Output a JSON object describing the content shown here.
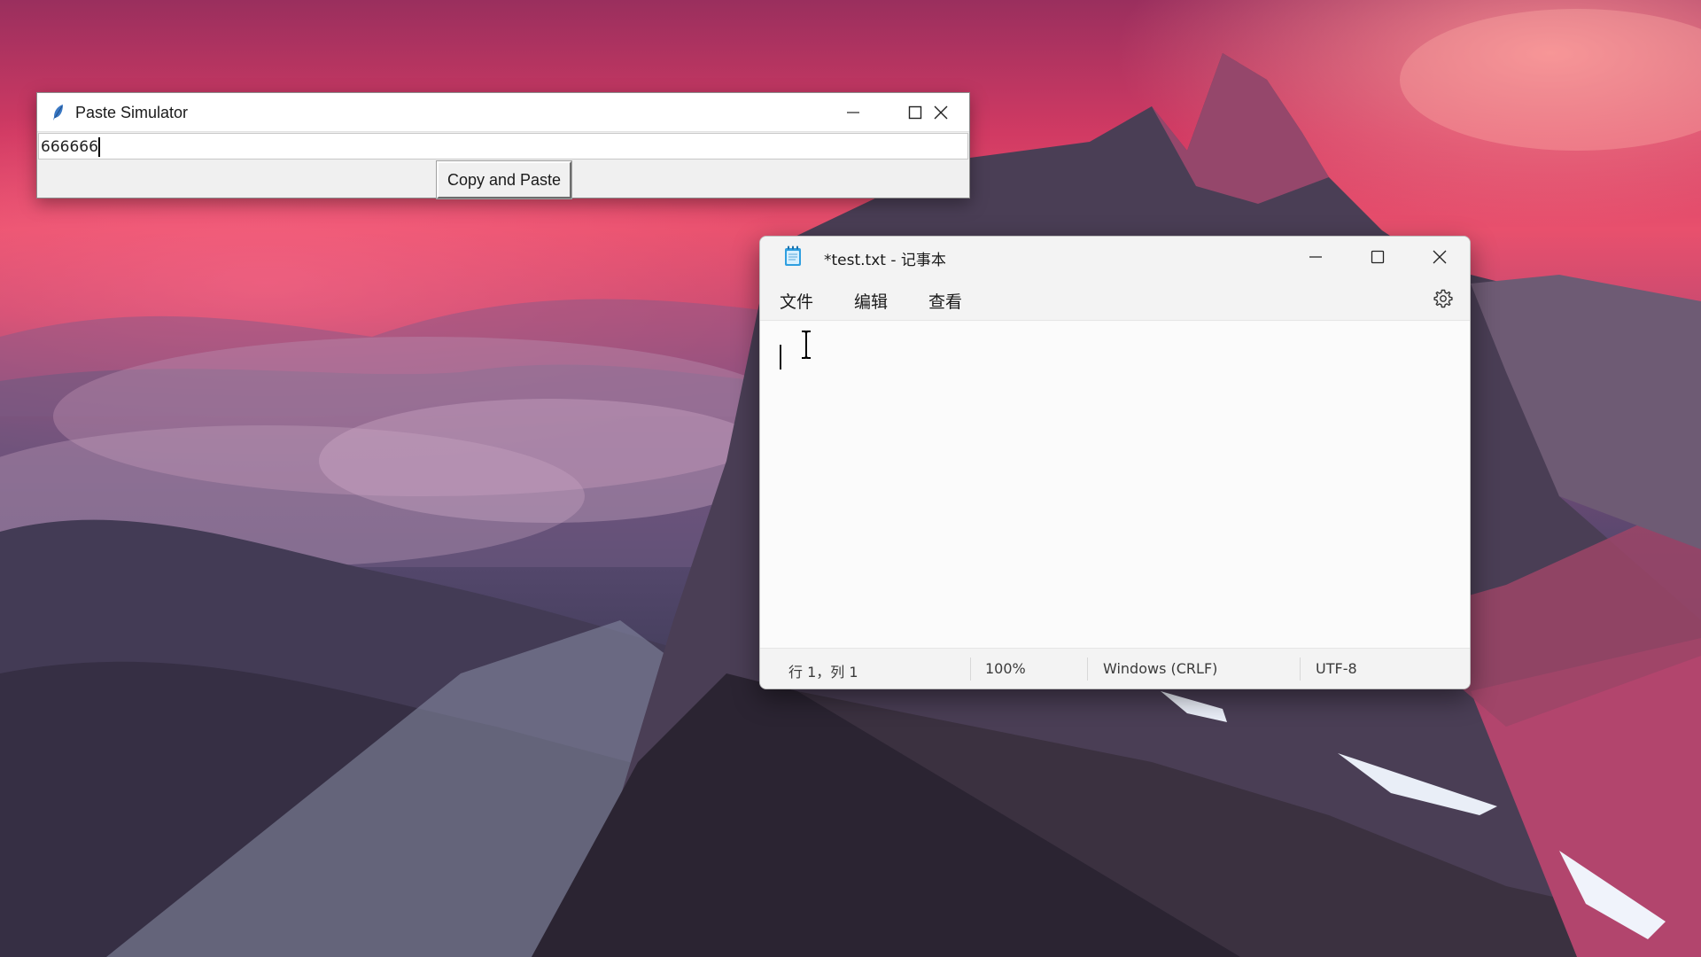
{
  "paste_simulator": {
    "title": "Paste Simulator",
    "entry_value": "666666",
    "button_label": "Copy and Paste",
    "icons": {
      "app": "feather-icon",
      "minimize": "minimize-icon",
      "maximize": "maximize-icon",
      "close": "close-icon"
    }
  },
  "notepad": {
    "title": "*test.txt - 记事本",
    "menu": [
      "文件",
      "编辑",
      "查看"
    ],
    "editor_text": "",
    "status": {
      "position": "行 1，列 1",
      "zoom": "100%",
      "line_ending": "Windows (CRLF)",
      "encoding": "UTF-8"
    },
    "icons": {
      "app": "notepad-icon",
      "settings": "gear-icon",
      "minimize": "minimize-icon",
      "maximize": "maximize-icon",
      "close": "close-icon"
    }
  },
  "colors": {
    "accent": "#1e8fd6",
    "window_bg": "#f9f9f9"
  }
}
